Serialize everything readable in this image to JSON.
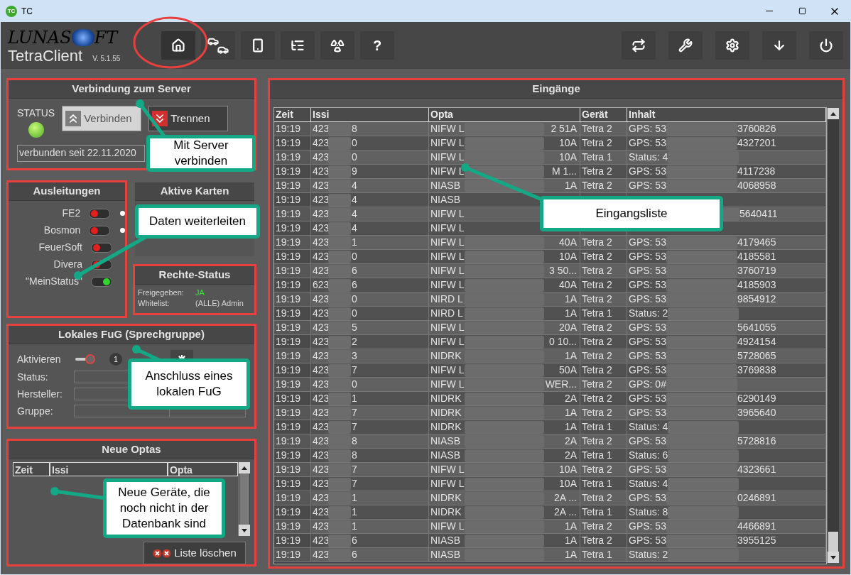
{
  "window": {
    "icon_text": "TC",
    "title": "TC"
  },
  "header": {
    "logo_left": "LUNAS",
    "logo_right": "FT",
    "app_name": "TetraClient",
    "version": "V. 5.1.55"
  },
  "toolbar_left": [
    {
      "selected": true
    },
    {
      "selected": false
    },
    {
      "selected": false
    },
    {
      "selected": false
    },
    {
      "selected": false
    },
    {
      "selected": false,
      "label": "?"
    }
  ],
  "toolbar_right": [
    {
      "selected": false
    },
    {
      "selected": false
    },
    {
      "selected": false
    },
    {
      "selected": false
    },
    {
      "selected": false
    }
  ],
  "server_panel": {
    "title": "Verbindung zum Server",
    "highlighted": true,
    "status_label": "STATUS",
    "connected": true,
    "buttons": [
      {
        "label": "Verbinden",
        "disabled": true
      },
      {
        "label": "Trennen",
        "disabled": false
      }
    ],
    "since": "verbunden seit 22.11.2020"
  },
  "outputs_panel": {
    "title": "Ausleitungen",
    "highlighted": true,
    "items": [
      {
        "name": "FE2",
        "on": false,
        "dot": true
      },
      {
        "name": "Bosmon",
        "on": false,
        "dot": true
      },
      {
        "name": "FeuerSoft",
        "on": false,
        "dot": false
      },
      {
        "name": "Divera",
        "on": false,
        "dot": false
      },
      {
        "name": "\"MeinStatus\"",
        "on": true,
        "dot": false
      }
    ]
  },
  "cards_panel": {
    "title": "Aktive Karten",
    "highlighted": false
  },
  "rights_panel": {
    "title": "Rechte-Status",
    "highlighted": true,
    "rows": [
      {
        "label": "Freigegeben:",
        "value": "JA",
        "ok": true
      },
      {
        "label": "Whitelist:",
        "value": "(ALLE) Admin",
        "ok": false
      }
    ]
  },
  "fug_panel": {
    "title": "Lokales FuG (Sprechgruppe)",
    "highlighted": true,
    "activate_label": "Aktivieren",
    "active": false,
    "badge": "1",
    "fields": [
      {
        "label": "Status:"
      },
      {
        "label": "Hersteller:"
      },
      {
        "label": "Gruppe:"
      }
    ]
  },
  "new_optas_panel": {
    "title": "Neue Optas",
    "highlighted": true,
    "columns": [
      "Zeit",
      "Issi",
      "Opta"
    ],
    "clear_button": "Liste löschen"
  },
  "inputs_panel": {
    "title": "Eingänge",
    "highlighted": true,
    "columns": [
      "Zeit",
      "Issi",
      "Opta",
      "Gerät",
      "Inhalt"
    ],
    "rows": [
      {
        "time": "19:19",
        "issi": [
          "423",
          "8"
        ],
        "opta": [
          "NIFW L",
          "2 51A"
        ],
        "device": "Tetra 2",
        "content": [
          "GPS: 53",
          "3760826"
        ]
      },
      {
        "time": "19:19",
        "issi": [
          "423",
          "0"
        ],
        "opta": [
          "NIFW L",
          "10A"
        ],
        "device": "Tetra 2",
        "content": [
          "GPS: 53",
          "4327201"
        ]
      },
      {
        "time": "19:19",
        "issi": [
          "423",
          "0"
        ],
        "opta": [
          "NIFW L",
          "10A"
        ],
        "device": "Tetra 1",
        "content": [
          "Status: 4"
        ]
      },
      {
        "time": "19:19",
        "issi": [
          "423",
          "9"
        ],
        "opta": [
          "NIFW L",
          "M  1..."
        ],
        "device": "Tetra 2",
        "content": [
          "GPS: 53",
          "4117238"
        ]
      },
      {
        "time": "19:19",
        "issi": [
          "423",
          "4"
        ],
        "opta": [
          "NIASB",
          "1A"
        ],
        "device": "Tetra 2",
        "content": [
          "GPS: 53",
          "4068958"
        ]
      },
      {
        "time": "19:19",
        "issi": [
          "423",
          "4"
        ],
        "opta": [
          "NIASB"
        ]
      },
      {
        "time": "19:19",
        "issi": [
          "423",
          "4"
        ],
        "opta": [
          "NIFW L"
        ],
        "content_tail": "5640411"
      },
      {
        "time": "19:19",
        "issi": [
          "423",
          "4"
        ],
        "opta": [
          "NIFW L"
        ]
      },
      {
        "time": "19:19",
        "issi": [
          "423",
          "1"
        ],
        "opta": [
          "NIFW L",
          "40A"
        ],
        "device": "Tetra 2",
        "content": [
          "GPS: 53",
          "4179465"
        ]
      },
      {
        "time": "19:19",
        "issi": [
          "423",
          "0"
        ],
        "opta": [
          "NIFW L",
          "10A"
        ],
        "device": "Tetra 2",
        "content": [
          "GPS: 53",
          "4185581"
        ]
      },
      {
        "time": "19:19",
        "issi": [
          "423",
          "6"
        ],
        "opta": [
          "NIFW L",
          "3 50..."
        ],
        "device": "Tetra 2",
        "content": [
          "GPS: 53",
          "3760719"
        ]
      },
      {
        "time": "19:19",
        "issi": [
          "623",
          "6"
        ],
        "opta": [
          "NIFW L",
          "40A"
        ],
        "device": "Tetra 2",
        "content": [
          "GPS: 53",
          "4185903"
        ]
      },
      {
        "time": "19:19",
        "issi": [
          "423",
          "0"
        ],
        "opta": [
          "NIRD L",
          "1A"
        ],
        "device": "Tetra 2",
        "content": [
          "GPS: 53",
          "9854912"
        ]
      },
      {
        "time": "19:19",
        "issi": [
          "423",
          "0"
        ],
        "opta": [
          "NIRD L",
          "1A"
        ],
        "device": "Tetra 1",
        "content": [
          "Status: 2"
        ]
      },
      {
        "time": "19:19",
        "issi": [
          "423",
          "5"
        ],
        "opta": [
          "NIFW L",
          "20A"
        ],
        "device": "Tetra 2",
        "content": [
          "GPS: 53",
          "5641055"
        ]
      },
      {
        "time": "19:19",
        "issi": [
          "423",
          "2"
        ],
        "opta": [
          "NIFW L",
          "0 10..."
        ],
        "device": "Tetra 2",
        "content": [
          "GPS: 53",
          "4924154"
        ]
      },
      {
        "time": "19:19",
        "issi": [
          "423",
          "3"
        ],
        "opta": [
          "NIDRK",
          "1A"
        ],
        "device": "Tetra 2",
        "content": [
          "GPS: 53",
          "5728065"
        ]
      },
      {
        "time": "19:19",
        "issi": [
          "423",
          "7"
        ],
        "opta": [
          "NIFW L",
          "50A"
        ],
        "device": "Tetra 2",
        "content": [
          "GPS: 53",
          "3769838"
        ]
      },
      {
        "time": "19:19",
        "issi": [
          "423",
          "0"
        ],
        "opta": [
          "NIFW L",
          "WER..."
        ],
        "device": "Tetra 2",
        "content": [
          "GPS: 0#"
        ]
      },
      {
        "time": "19:19",
        "issi": [
          "423",
          "1"
        ],
        "opta": [
          "NIDRK",
          "2A"
        ],
        "device": "Tetra 2",
        "content": [
          "GPS: 53",
          "6290149"
        ]
      },
      {
        "time": "19:19",
        "issi": [
          "423",
          "7"
        ],
        "opta": [
          "NIDRK",
          "1A"
        ],
        "device": "Tetra 2",
        "content": [
          "GPS: 53",
          "3965640"
        ]
      },
      {
        "time": "19:19",
        "issi": [
          "423",
          "7"
        ],
        "opta": [
          "NIDRK",
          "1A"
        ],
        "device": "Tetra 1",
        "content": [
          "Status: 4"
        ]
      },
      {
        "time": "19:19",
        "issi": [
          "423",
          "8"
        ],
        "opta": [
          "NIASB",
          "2A"
        ],
        "device": "Tetra 2",
        "content": [
          "GPS: 53",
          "5728816"
        ]
      },
      {
        "time": "19:19",
        "issi": [
          "423",
          "8"
        ],
        "opta": [
          "NIASB",
          "2A"
        ],
        "device": "Tetra 1",
        "content": [
          "Status: 6"
        ]
      },
      {
        "time": "19:19",
        "issi": [
          "423",
          "7"
        ],
        "opta": [
          "NIFW L",
          "10A"
        ],
        "device": "Tetra 2",
        "content": [
          "GPS: 53",
          "4323661"
        ]
      },
      {
        "time": "19:19",
        "issi": [
          "423",
          "7"
        ],
        "opta": [
          "NIFW L",
          "10A"
        ],
        "device": "Tetra 1",
        "content": [
          "Status: 4"
        ]
      },
      {
        "time": "19:19",
        "issi": [
          "423",
          "1"
        ],
        "opta": [
          "NIDRK",
          "2A ..."
        ],
        "device": "Tetra 2",
        "content": [
          "GPS: 53",
          "0246891"
        ]
      },
      {
        "time": "19:19",
        "issi": [
          "423",
          "1"
        ],
        "opta": [
          "NIDRK",
          "2A ..."
        ],
        "device": "Tetra 1",
        "content": [
          "Status: 8"
        ]
      },
      {
        "time": "19:19",
        "issi": [
          "423",
          "1"
        ],
        "opta": [
          "NIFW L",
          "1A"
        ],
        "device": "Tetra 2",
        "content": [
          "GPS: 53",
          "4466891"
        ]
      },
      {
        "time": "19:19",
        "issi": [
          "423",
          "6"
        ],
        "opta": [
          "NIASB",
          "1A"
        ],
        "device": "Tetra 2",
        "content": [
          "GPS: 53",
          "3955125"
        ]
      },
      {
        "time": "19:19",
        "issi": [
          "423",
          "6"
        ],
        "opta": [
          "NIASB",
          "1A"
        ],
        "device": "Tetra 1",
        "content": [
          "Status: 2"
        ]
      }
    ]
  },
  "callouts": [
    {
      "text": "Mit Server verbinden"
    },
    {
      "text": "Daten weiterleiten"
    },
    {
      "text": "Anschluss eines lokalen FuG"
    },
    {
      "text": "Eingangsliste"
    },
    {
      "text": "Neue Geräte, die noch nicht in der Datenbank sind"
    }
  ]
}
